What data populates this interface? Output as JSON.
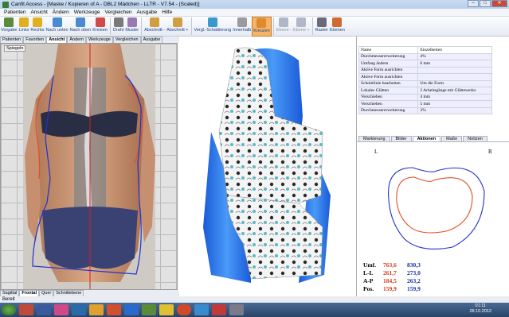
{
  "window": {
    "title": "Canfit Access - [Maske / Kopieren of A - DBL2 Mädchen - LLTR - V7.54 - (Scaled)]"
  },
  "menu": [
    "Patienten",
    "Ansicht",
    "Ändern",
    "Werkzeuge",
    "Vergleichen",
    "Ausgabe",
    "Hilfe"
  ],
  "toolbar": [
    {
      "label": "Vorgabe",
      "icon": "preset-icon",
      "color": "#5a8a3a"
    },
    {
      "label": "Links",
      "icon": "check-left-icon",
      "color": "#e0b020"
    },
    {
      "label": "Rechts",
      "icon": "check-right-icon",
      "color": "#e0b020"
    },
    {
      "label": "Nach unten",
      "icon": "arrow-down-icon",
      "color": "#4a8ad0"
    },
    {
      "label": "Nach oben",
      "icon": "arrow-up-icon",
      "color": "#4a8ad0"
    },
    {
      "label": "Kreisen",
      "icon": "rotate-icon",
      "color": "#d04a4a"
    },
    {
      "label": "Draht",
      "icon": "wireframe-icon",
      "color": "#7a7a7a"
    },
    {
      "label": "Muster",
      "icon": "pattern-icon",
      "color": "#9a7ab0"
    },
    {
      "label": "Abschnitt -",
      "icon": "section-minus-icon",
      "color": "#d0a040"
    },
    {
      "label": "Abschnitt +",
      "icon": "section-plus-icon",
      "color": "#d0a040"
    },
    {
      "label": "Vergl.-Schattierung",
      "icon": "compare-shading-icon",
      "color": "#3a9ad0"
    },
    {
      "label": "Innerhalb",
      "icon": "inside-icon",
      "color": "#9a9aa0"
    },
    {
      "label": "Kreuzen",
      "icon": "cross-icon",
      "color": "#e08a30"
    },
    {
      "label": "Ebene -",
      "icon": "plane-minus-icon",
      "color": "#b0b8c8"
    },
    {
      "label": "Ebene +",
      "icon": "plane-plus-icon",
      "color": "#b0b8c8"
    },
    {
      "label": "Raster",
      "icon": "grid-icon",
      "color": "#6a6a7a"
    },
    {
      "label": "Ebenen",
      "icon": "layers-icon",
      "color": "#d06a30"
    }
  ],
  "left_tabs": [
    "Patienten",
    "Favoriten",
    "Ansicht",
    "Ändern",
    "Werkzeuge",
    "Vergleichen",
    "Ausgabe"
  ],
  "left_selected_tab": "Ansicht",
  "spiegeln": "Spiegeln",
  "bottom_tabs": [
    "Sagittal",
    "Frontal",
    "Quer",
    "Schnittebene"
  ],
  "props": {
    "header": [
      "Name",
      "Einzelheiten"
    ],
    "rows": [
      [
        "Durchmessererweiterung",
        "4%"
      ],
      [
        "Umfang ändern",
        "6 mm"
      ],
      [
        "Aktive Form ausrichten",
        ""
      ],
      [
        "Aktive Form ausrichten",
        ""
      ],
      [
        "Schnittlinie bearbeiten",
        "Um die Form"
      ],
      [
        "Lokales Glätten",
        "2 Arbeitsgänge mit Glättewerkz"
      ],
      [
        "Verschieben",
        "4 mm"
      ],
      [
        "Verschieben",
        "5 mm"
      ],
      [
        "Durchmessererweiterung",
        "3%"
      ]
    ]
  },
  "right_tabs": [
    "Markierung",
    "Bilder",
    "Aktionen",
    "Maße",
    "Notizen"
  ],
  "right_selected_tab": "Aktionen",
  "side_labels": {
    "left": "L",
    "right": "R"
  },
  "measurements": [
    {
      "key": "Umf.",
      "red": "763,6",
      "blue": "830,3"
    },
    {
      "key": "L-L",
      "red": "261,7",
      "blue": "273,0"
    },
    {
      "key": "A-P",
      "red": "184,5",
      "blue": "263,2"
    },
    {
      "key": "Pos.",
      "red": "159,9",
      "blue": "159,9"
    }
  ],
  "status": "Bereit",
  "clock": {
    "time": "01:11",
    "date": "28.10.2012"
  },
  "colors": {
    "red_outline": "#e05020",
    "blue_outline": "#2030d0",
    "brace_blue": "#2a7ae8"
  }
}
